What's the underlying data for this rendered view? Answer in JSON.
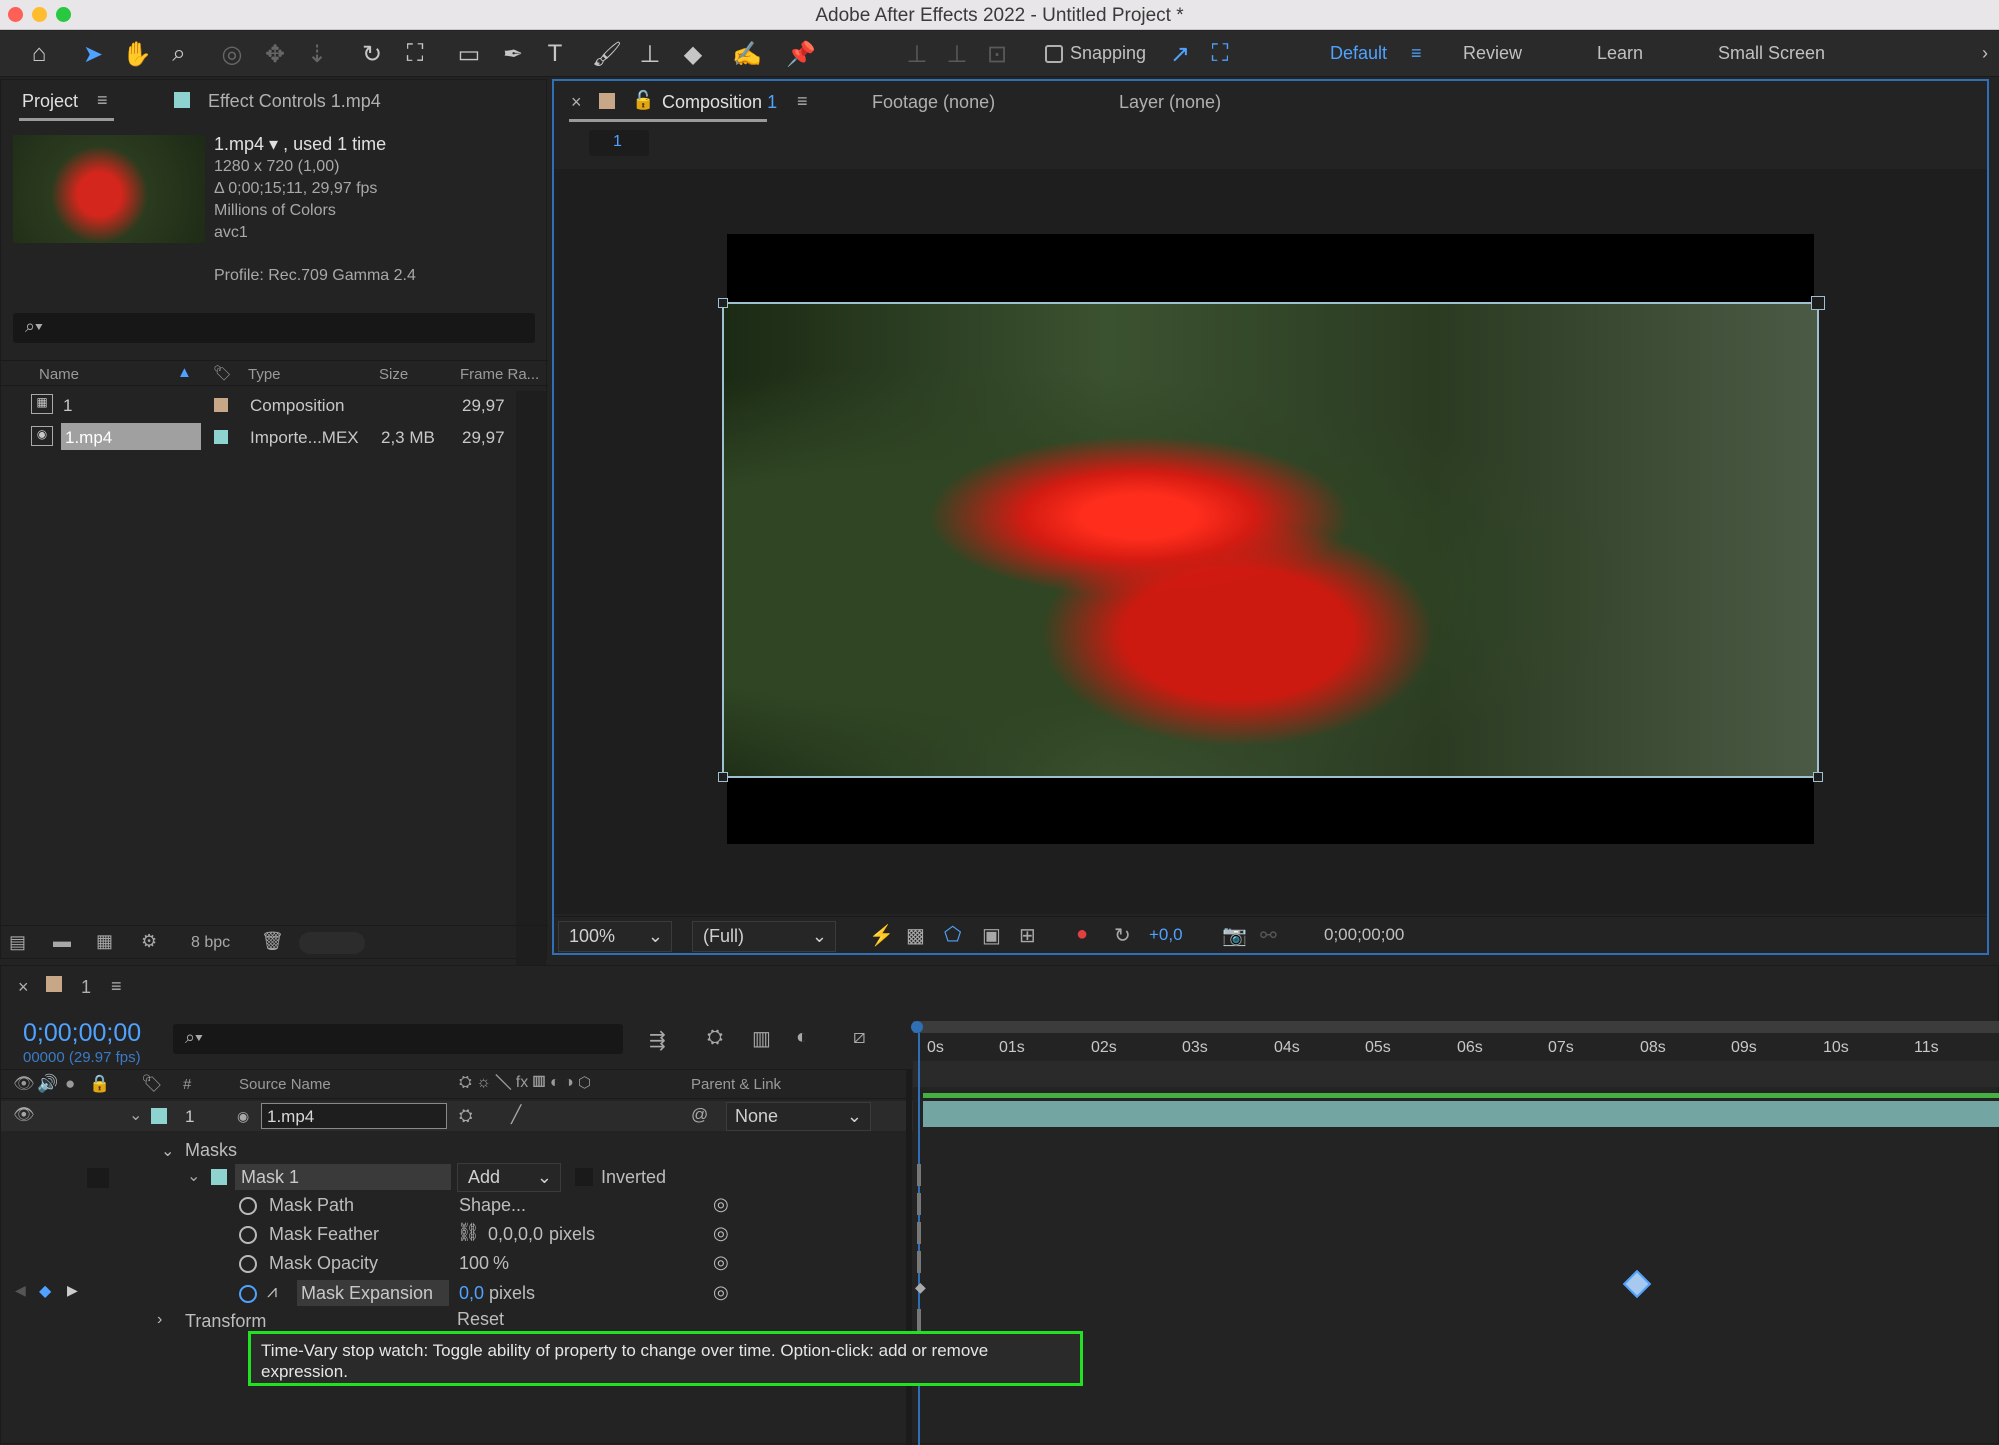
{
  "window": {
    "title": "Adobe After Effects 2022 - Untitled Project *"
  },
  "toolbar": {
    "snapping_label": "Snapping",
    "workspaces": [
      "Default",
      "Review",
      "Learn",
      "Small Screen"
    ]
  },
  "project_panel": {
    "tab_project": "Project",
    "tab_effect_controls": "Effect Controls 1.mp4",
    "info": {
      "name": "1.mp4",
      "used": ", used 1 time",
      "resolution": "1280 x 720 (1,00)",
      "duration": "Δ 0;00;15;11, 29,97 fps",
      "colors": "Millions of Colors",
      "codec": "avc1",
      "profile": "Profile: Rec.709 Gamma 2.4"
    },
    "columns": {
      "name": "Name",
      "type": "Type",
      "size": "Size",
      "frame_rate": "Frame Ra..."
    },
    "items": [
      {
        "name": "1",
        "type": "Composition",
        "size": "",
        "fps": "29,97"
      },
      {
        "name": "1.mp4",
        "type": "Importe...MEX",
        "size": "2,3 MB",
        "fps": "29,97"
      }
    ],
    "bpc": "8 bpc"
  },
  "viewer": {
    "tab_composition": "Composition",
    "tab_composition_num": "1",
    "tab_footage": "Footage (none)",
    "tab_layer": "Layer (none)",
    "breadcrumb": "1",
    "zoom": "100%",
    "resolution": "(Full)",
    "exposure": "+0,0",
    "timecode": "0;00;00;00"
  },
  "timeline": {
    "tab_label": "1",
    "timecode": "0;00;00;00",
    "frames": "00000 (29.97 fps)",
    "columns": {
      "num": "#",
      "source_name": "Source Name",
      "parent": "Parent & Link"
    },
    "ruler": [
      "0s",
      "01s",
      "02s",
      "03s",
      "04s",
      "05s",
      "06s",
      "07s",
      "08s",
      "09s",
      "10s",
      "11s"
    ],
    "layer": {
      "num": "1",
      "name": "1.mp4",
      "parent": "None"
    },
    "masks_label": "Masks",
    "mask": {
      "name": "Mask 1",
      "mode": "Add",
      "inverted_label": "Inverted"
    },
    "properties": [
      {
        "label": "Mask Path",
        "value": "Shape...",
        "unit": ""
      },
      {
        "label": "Mask Feather",
        "value": "0,0,0,0",
        "unit": "pixels"
      },
      {
        "label": "Mask Opacity",
        "value": "100",
        "unit": "%"
      },
      {
        "label": "Mask Expansion",
        "value": "0,0",
        "unit": "pixels"
      }
    ],
    "transform_label": "Transform",
    "transform_value": "Reset",
    "tooltip": "Time-Vary stop watch: Toggle ability of property to change over time. Option-click: add or remove expression."
  }
}
